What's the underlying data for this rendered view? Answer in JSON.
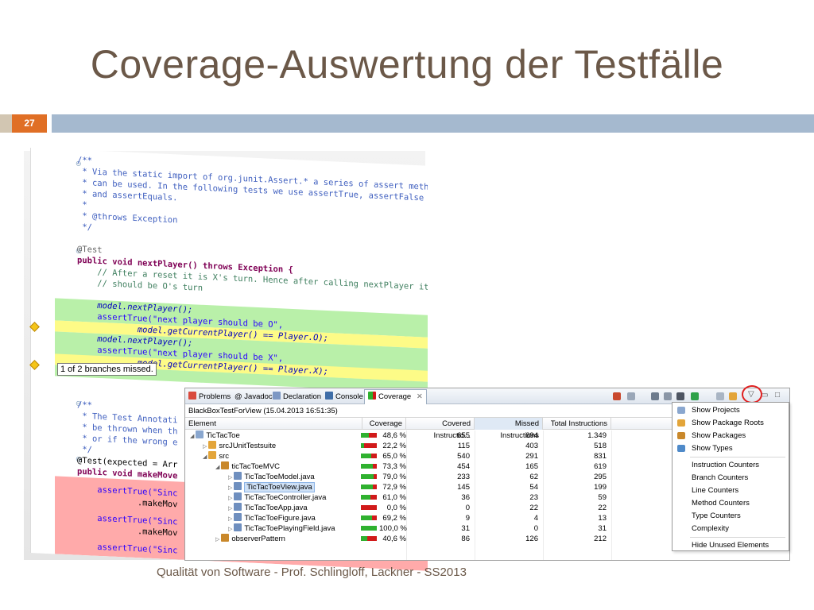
{
  "slide": {
    "title": "Coverage-Auswertung der Testfälle",
    "number": "27",
    "footer": "Qualität von Software - Prof. Schlingloff, Lackner - SS2013",
    "colors": {
      "title": "#6b5848",
      "number_box": "#e06f25",
      "rule": "#a5b9cf"
    }
  },
  "code": {
    "lines": [
      "/**",
      " * Via the static import of org.junit.Assert.* a series of assert methods",
      " * can be used. In the following tests we use assertTrue, assertFalse",
      " * and assertEquals.",
      " *",
      " * @throws Exception",
      " */",
      "@Test",
      "public void nextPlayer() throws Exception {",
      "    // After a reset it is X's turn. Hence after calling nextPlayer it",
      "    // should be O's turn",
      "    model.nextPlayer();",
      "    assertTrue(\"next player should be O\",",
      "            model.getCurrentPlayer() == Player.O);",
      "    model.nextPlayer();",
      "    assertTrue(\"next player should be X\",",
      "            model.getCurrentPlayer() == Player.X);",
      "}",
      "",
      "/**",
      " * The Test Annotati",
      " * be thrown when th",
      " * or if the wrong e",
      " */",
      "@Test(expected = Arr",
      "public void makeMove",
      "    assertTrue(\"Sinc",
      "            .makeMov",
      "    assertTrue(\"Sinc",
      "            .makeMov",
      "    assertTrue(\"Sinc"
    ],
    "tooltip": "1 of 2 branches missed."
  },
  "coverage_view": {
    "tabs": [
      "Problems",
      "@ Javadoc",
      "Declaration",
      "Console",
      "Coverage"
    ],
    "session": "BlackBoxTestForView (15.04.2013 16:51:35)",
    "columns": [
      "Element",
      "Coverage",
      "Covered Instructio...",
      "Missed Instructions",
      "Total Instructions"
    ],
    "rows": [
      {
        "name": "TicTacToe",
        "coverage": "48,6 %",
        "covered": "655",
        "missed": "694",
        "total": "1.349",
        "ratio": 0.486
      },
      {
        "name": "srcJUnitTestsuite",
        "coverage": "22,2 %",
        "covered": "115",
        "missed": "403",
        "total": "518",
        "ratio": 0.222
      },
      {
        "name": "src",
        "coverage": "65,0 %",
        "covered": "540",
        "missed": "291",
        "total": "831",
        "ratio": 0.65
      },
      {
        "name": "ticTacToeMVC",
        "coverage": "73,3 %",
        "covered": "454",
        "missed": "165",
        "total": "619",
        "ratio": 0.733
      },
      {
        "name": "TicTacToeModel.java",
        "coverage": "79,0 %",
        "covered": "233",
        "missed": "62",
        "total": "295",
        "ratio": 0.79
      },
      {
        "name": "TicTacToeView.java",
        "coverage": "72,9 %",
        "covered": "145",
        "missed": "54",
        "total": "199",
        "ratio": 0.729
      },
      {
        "name": "TicTacToeController.java",
        "coverage": "61,0 %",
        "covered": "36",
        "missed": "23",
        "total": "59",
        "ratio": 0.61
      },
      {
        "name": "TicTacToeApp.java",
        "coverage": "0,0 %",
        "covered": "0",
        "missed": "22",
        "total": "22",
        "ratio": 0.0
      },
      {
        "name": "TicTacToeFigure.java",
        "coverage": "69,2 %",
        "covered": "9",
        "missed": "4",
        "total": "13",
        "ratio": 0.692
      },
      {
        "name": "TicTacToePlayingField.java",
        "coverage": "100,0 %",
        "covered": "31",
        "missed": "0",
        "total": "31",
        "ratio": 1.0
      },
      {
        "name": "observerPattern",
        "coverage": "40,6 %",
        "covered": "86",
        "missed": "126",
        "total": "212",
        "ratio": 0.406
      }
    ]
  },
  "menu": {
    "items": [
      "Show Projects",
      "Show Package Roots",
      "Show Packages",
      "Show Types",
      "Instruction Counters",
      "Branch Counters",
      "Line Counters",
      "Method Counters",
      "Type Counters",
      "Complexity",
      "Hide Unused Elements"
    ]
  }
}
